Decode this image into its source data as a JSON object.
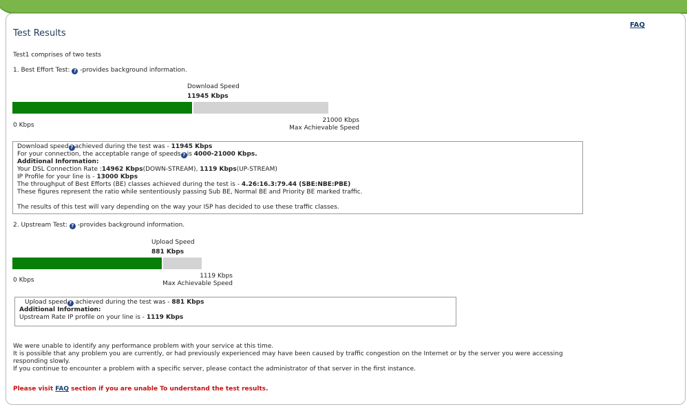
{
  "faq_link": "FAQ",
  "title": "Test Results",
  "intro": "Test1 comprises of two tests",
  "test1": {
    "label": "1. Best Effort Test:",
    "help_text": "-provides background information.",
    "bar_title": "Download Speed",
    "bar_value": "11945 Kbps",
    "measured_kbps": 11945,
    "max_kbps": 21000,
    "min_label": "0 Kbps",
    "max_label": "21000 Kbps",
    "max_caption": "Max Achievable Speed",
    "box": {
      "line1_a": "Download speed",
      "line1_b": "achieved during the test was - ",
      "line1_v": "11945 Kbps",
      "line2_a": "For your connection, the acceptable range of speeds",
      "line2_b": "is ",
      "line2_v": "4000-21000 Kbps.",
      "line3": "Additional Information:",
      "line4_a": "Your DSL Connection Rate :",
      "line4_v1": "14962 Kbps",
      "line4_b": "(DOWN-STREAM), ",
      "line4_v2": "1119 Kbps",
      "line4_c": "(UP-STREAM)",
      "line5_a": "IP Profile for your line is - ",
      "line5_v": "13000 Kbps",
      "line6_a": "The throughput of Best Efforts (BE) classes achieved during the test is - ",
      "line6_v": "4.26:16.3:79.44 (SBE:NBE:PBE)",
      "line7": "These figures represent the ratio while sententiously passing Sub BE, Normal BE and Priority BE marked traffic.",
      "line8": "The results of this test will vary depending on the way your ISP has decided to use these traffic classes."
    }
  },
  "test2": {
    "label": "2. Upstream Test:",
    "help_text": "-provides background information.",
    "bar_title": "Upload Speed",
    "bar_value": "881 Kbps",
    "measured_kbps": 881,
    "max_kbps": 1119,
    "min_label": "0 Kbps",
    "max_label": "1119 Kbps",
    "max_caption": "Max Achievable Speed",
    "box": {
      "line1_a": "Upload speed",
      "line1_b": " achieved during the test was - ",
      "line1_v": "881 Kbps",
      "line2": "Additional Information:",
      "line3_a": "Upstream Rate IP profile on your line is - ",
      "line3_v": "1119 Kbps"
    }
  },
  "summary": {
    "line1": "We were unable to identify any performance problem with your service at this time.",
    "line2": "It is possible that any problem you are currently, or had previously experienced may have been caused by traffic congestion on the Internet or by the server you were accessing",
    "line3": "responding slowly.",
    "line4": "If you continue to encounter a problem with a specific server, please contact the administrator of that server in the first instance."
  },
  "footer": {
    "prefix": "Please visit ",
    "link": "FAQ",
    "suffix": " section if you are unable To understand the test results."
  },
  "colors": {
    "bar_fill": "#087f07",
    "bar_rest": "#d3d3d3",
    "brand_green": "#7bb64a",
    "warning": "#c41010"
  }
}
